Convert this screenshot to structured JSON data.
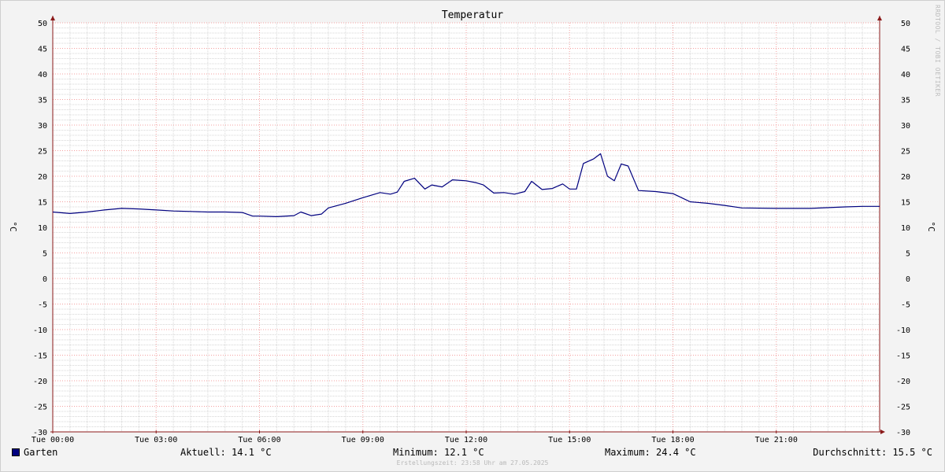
{
  "colors": {
    "series": "#00007f",
    "background": "#f3f3f3",
    "canvas": "#ffffff",
    "major_grid": "#f4a0a0",
    "minor_grid": "#d7d7d7",
    "axis": "#8b1a1a"
  },
  "watermark": "RRDTOOL / TOBI OETIKER",
  "legend": {
    "series_name": "Garten",
    "current": "Aktuell: 14.1 °C",
    "minimum": "Minimum: 12.1 °C",
    "maximum": "Maximum: 24.4 °C",
    "average": "Durchschnitt: 15.5 °C"
  },
  "footer": "Erstellungszeit: 23:58 Uhr am 27.05.2025",
  "chart_data": {
    "type": "line",
    "title": "Temperatur",
    "ylabel": "°C",
    "ylabel_right": "°C",
    "ylim": [
      -30,
      50
    ],
    "y_ticks": [
      50,
      45,
      40,
      35,
      30,
      25,
      20,
      15,
      10,
      5,
      0,
      -5,
      -10,
      -15,
      -20,
      -25,
      -30
    ],
    "xlim": [
      0,
      24
    ],
    "x_ticks": [
      {
        "x": 0,
        "label": "Tue 00:00"
      },
      {
        "x": 3,
        "label": "Tue 03:00"
      },
      {
        "x": 6,
        "label": "Tue 06:00"
      },
      {
        "x": 9,
        "label": "Tue 09:00"
      },
      {
        "x": 12,
        "label": "Tue 12:00"
      },
      {
        "x": 15,
        "label": "Tue 15:00"
      },
      {
        "x": 18,
        "label": "Tue 18:00"
      },
      {
        "x": 21,
        "label": "Tue 21:00"
      }
    ],
    "grid": true,
    "series": [
      {
        "name": "Garten",
        "x": [
          0,
          0.5,
          1.0,
          1.5,
          2.0,
          2.5,
          3.0,
          3.5,
          4.0,
          4.5,
          5.0,
          5.5,
          5.8,
          6.0,
          6.5,
          7.0,
          7.2,
          7.5,
          7.8,
          8.0,
          8.5,
          9.0,
          9.5,
          9.8,
          10.0,
          10.2,
          10.5,
          10.8,
          11.0,
          11.3,
          11.6,
          12.0,
          12.3,
          12.5,
          12.8,
          13.1,
          13.4,
          13.7,
          13.9,
          14.2,
          14.5,
          14.8,
          15.0,
          15.2,
          15.4,
          15.7,
          15.9,
          16.1,
          16.3,
          16.5,
          16.7,
          17.0,
          17.5,
          18.0,
          18.5,
          19.0,
          19.5,
          20.0,
          21.0,
          22.0,
          23.0,
          23.5,
          24.0
        ],
        "values": [
          13.0,
          12.7,
          13.0,
          13.4,
          13.7,
          13.6,
          13.4,
          13.2,
          13.1,
          13.0,
          13.0,
          12.9,
          12.2,
          12.2,
          12.1,
          12.3,
          13.0,
          12.3,
          12.6,
          13.8,
          14.7,
          15.8,
          16.8,
          16.5,
          16.9,
          19.0,
          19.6,
          17.5,
          18.3,
          17.9,
          19.3,
          19.1,
          18.7,
          18.3,
          16.7,
          16.8,
          16.5,
          17.0,
          19.0,
          17.4,
          17.6,
          18.5,
          17.5,
          17.5,
          22.5,
          23.4,
          24.4,
          20.0,
          19.1,
          22.4,
          22.0,
          17.2,
          17.0,
          16.6,
          15.0,
          14.7,
          14.3,
          13.8,
          13.7,
          13.7,
          14.0,
          14.1,
          14.1
        ]
      }
    ]
  }
}
